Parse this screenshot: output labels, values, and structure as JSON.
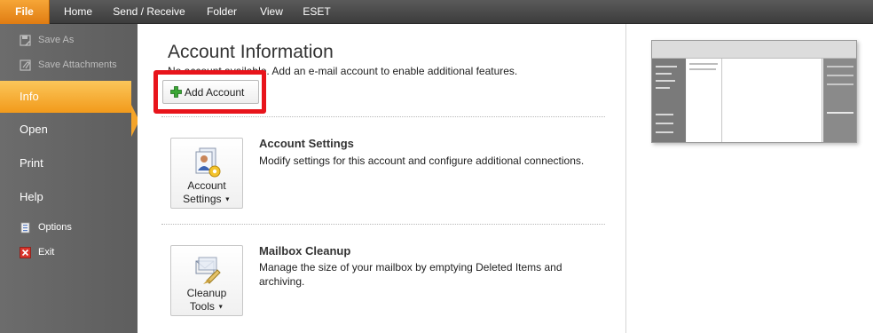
{
  "tabs": [
    "File",
    "Home",
    "Send / Receive",
    "Folder",
    "View",
    "ESET"
  ],
  "nav": {
    "save_as": "Save As",
    "save_attachments": "Save Attachments",
    "info": "Info",
    "open": "Open",
    "print": "Print",
    "help": "Help",
    "options": "Options",
    "exit": "Exit"
  },
  "main": {
    "title": "Account Information",
    "subtitle": "No account available. Add an e-mail account to enable additional features.",
    "add_account": "Add Account",
    "account_settings": {
      "button_line1": "Account",
      "button_line2": "Settings",
      "title": "Account Settings",
      "desc": "Modify settings for this account and configure additional connections."
    },
    "mailbox_cleanup": {
      "button_line1": "Cleanup",
      "button_line2": "Tools",
      "title": "Mailbox Cleanup",
      "desc": "Manage the size of your mailbox by emptying Deleted Items and archiving."
    }
  },
  "colors": {
    "accent_orange": "#f29a1b",
    "highlight_red": "#e8141b",
    "nav_gray": "#666666"
  }
}
